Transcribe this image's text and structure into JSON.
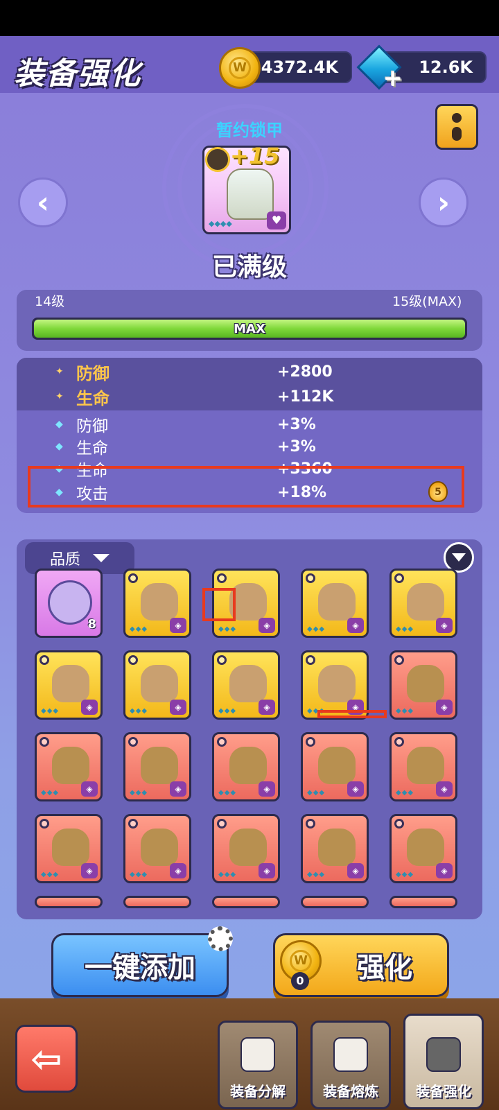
{
  "header": {
    "title": "装备强化",
    "coins": "4372.4K",
    "gems": "12.6K"
  },
  "item": {
    "name": "暂约锁甲",
    "enhance_level": "+15",
    "status": "已满级"
  },
  "level": {
    "current": "14级",
    "max": "15级(MAX)",
    "bar_label": "MAX",
    "progress_fraction": 1.0
  },
  "stats": [
    {
      "name": "防御",
      "value": "+2800",
      "kind": "main"
    },
    {
      "name": "生命",
      "value": "+112K",
      "kind": "main"
    },
    {
      "name": "防御",
      "value": "+3%",
      "kind": "sub"
    },
    {
      "name": "生命",
      "value": "+3%",
      "kind": "sub"
    },
    {
      "name": "生命",
      "value": "+3360",
      "kind": "sub"
    },
    {
      "name": "攻击",
      "value": "+18%",
      "kind": "sub"
    }
  ],
  "stat_badge": "5",
  "inventory": {
    "filter_label": "品质",
    "material_count": "8",
    "rows": [
      [
        "purple",
        "gold",
        "gold",
        "gold",
        "gold"
      ],
      [
        "gold",
        "gold",
        "gold",
        "gold",
        "red"
      ],
      [
        "red",
        "red",
        "red",
        "red",
        "red"
      ],
      [
        "red",
        "red",
        "red",
        "red",
        "red"
      ]
    ]
  },
  "actions": {
    "auto_add": "一键添加",
    "enhance": "强化",
    "enhance_cost": "0"
  },
  "tabs": [
    {
      "label": "装备分解"
    },
    {
      "label": "装备熔炼"
    },
    {
      "label": "装备强化"
    }
  ]
}
